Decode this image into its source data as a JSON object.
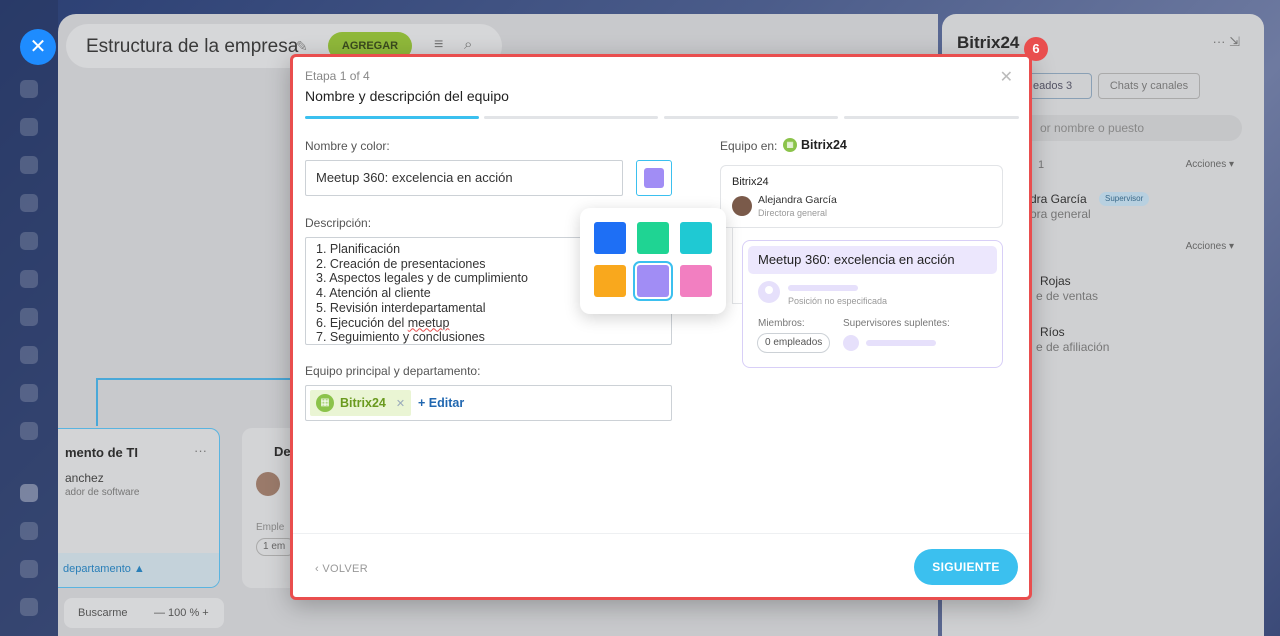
{
  "background": {
    "close_icon": "close-icon",
    "page_title": "Estructura de la empresa",
    "add_button": "AGREGAR",
    "dept_card": {
      "title": "mento de TI",
      "person": "anchez",
      "role": "ador de software",
      "footer": "departamento ▲"
    },
    "dept_card2": {
      "title": "De",
      "employees_label": "Emple",
      "count": "1 em"
    },
    "zoom": {
      "find_me": "Buscarme",
      "value": "—  100 %  +"
    }
  },
  "drawer": {
    "title": "Bitrix24",
    "tab_employees": "eados 3",
    "tab_chats": "Chats y canales",
    "search_placeholder": "or nombre o puesto",
    "actions_label": "Acciones ▾",
    "group_count": "1",
    "person1_name": "dra García",
    "person1_badge": "Supervisor",
    "person1_role": "ora general",
    "person2_name": "Rojas",
    "person2_role": "e de ventas",
    "person3_name": "Ríos",
    "person3_role": "e de afiliación"
  },
  "modal": {
    "step_badge": "6",
    "stage": "Etapa 1 of 4",
    "title": "Nombre y descripción del equipo",
    "name_color_label": "Nombre y color:",
    "name_value": "Meetup 360: excelencia en acción",
    "description_label": "Descripción:",
    "description_lines": [
      "1. Planificación",
      "2. Creación de presentaciones",
      "3. Aspectos legales y de cumplimiento",
      "4. Atención al cliente",
      "5. Revisión interdepartamental",
      "6. Ejecución del ",
      "7. Seguimiento y conclusiones"
    ],
    "misspelled_word": "meetup",
    "team_label": "Equipo principal y departamento:",
    "team_chip": "Bitrix24",
    "edit_link": "+ Editar",
    "team_in_label": "Equipo en:",
    "team_in_name": "Bitrix24",
    "org_card": {
      "title": "Bitrix24",
      "person": "Alejandra García",
      "role": "Directora general"
    },
    "new_team_card": {
      "name": "Meetup 360: excelencia en acción",
      "position": "Posición no especificada",
      "members_label": "Miembros:",
      "deputies_label": "Supervisores suplentes:",
      "members_count": "0 empleados"
    },
    "back_button": "VOLVER",
    "next_button": "SIGUIENTE",
    "progress_steps": 4,
    "progress_current": 1,
    "selected_color": "#a18df5",
    "palette": [
      "#1e6ff5",
      "#1fd493",
      "#1fc9d3",
      "#f9a81d",
      "#a18df5",
      "#f27fc1"
    ]
  }
}
